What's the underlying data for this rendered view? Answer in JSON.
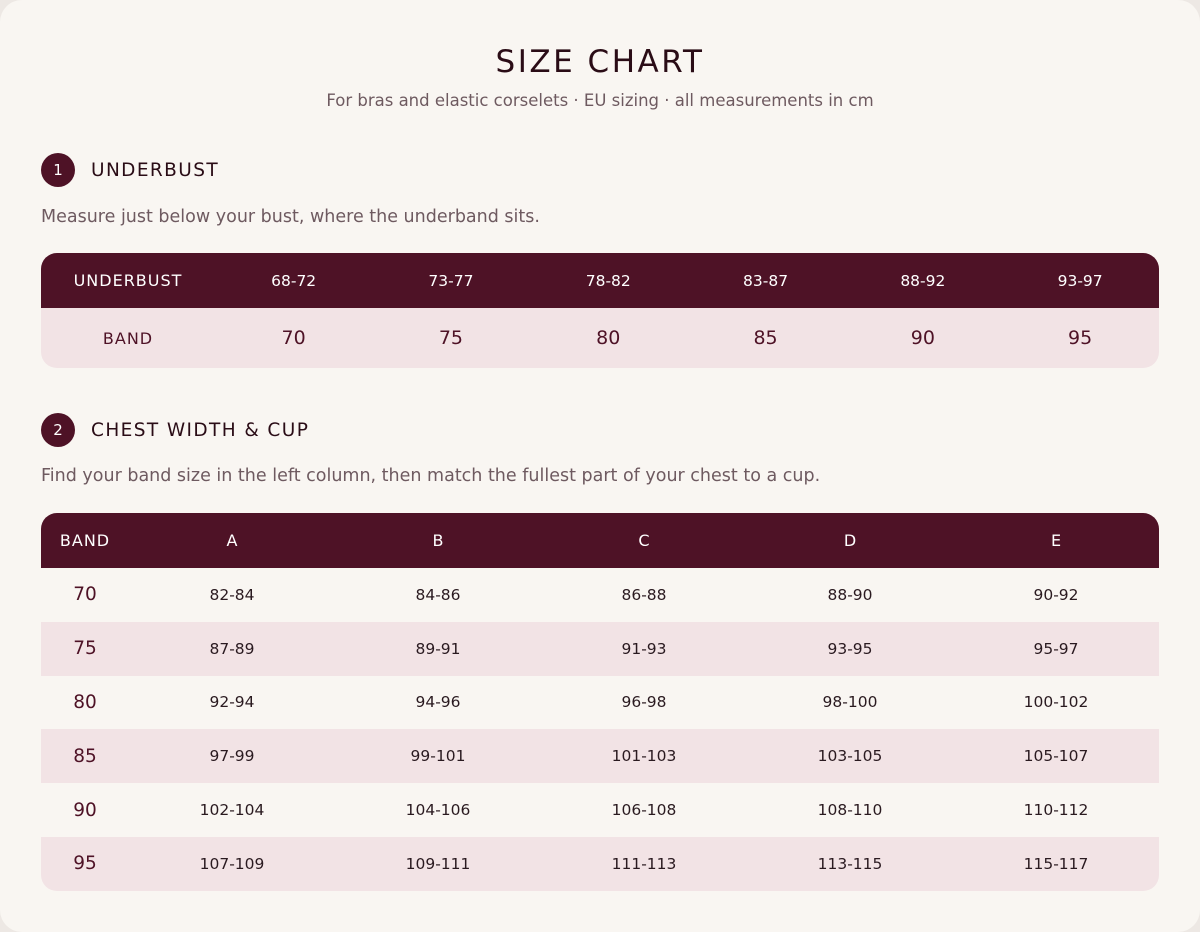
{
  "header": {
    "title": "SIZE CHART",
    "subtitle": "For bras and elastic corselets · EU sizing · all measurements in cm"
  },
  "section1": {
    "number": "1",
    "title": "UNDERBUST",
    "description": "Measure just below your bust, where the underband sits.",
    "row_header_label": "UNDERBUST",
    "row_band_label": "BAND",
    "underbust_ranges": [
      "68-72",
      "73-77",
      "78-82",
      "83-87",
      "88-92",
      "93-97"
    ],
    "band_sizes": [
      "70",
      "75",
      "80",
      "85",
      "90",
      "95"
    ]
  },
  "section2": {
    "number": "2",
    "title": "CHEST WIDTH & CUP",
    "description": "Find your band size in the left column, then match the fullest part of your chest to a cup.",
    "band_header": "BAND",
    "cups": [
      "A",
      "B",
      "C",
      "D",
      "E"
    ],
    "rows": [
      {
        "band": "70",
        "values": [
          "82-84",
          "84-86",
          "86-88",
          "88-90",
          "90-92"
        ]
      },
      {
        "band": "75",
        "values": [
          "87-89",
          "89-91",
          "91-93",
          "93-95",
          "95-97"
        ]
      },
      {
        "band": "80",
        "values": [
          "92-94",
          "94-96",
          "96-98",
          "98-100",
          "100-102"
        ]
      },
      {
        "band": "85",
        "values": [
          "97-99",
          "99-101",
          "101-103",
          "103-105",
          "105-107"
        ]
      },
      {
        "band": "90",
        "values": [
          "102-104",
          "104-106",
          "106-108",
          "108-110",
          "110-112"
        ]
      },
      {
        "band": "95",
        "values": [
          "107-109",
          "109-111",
          "111-113",
          "113-115",
          "115-117"
        ]
      }
    ]
  },
  "colors": {
    "accent": "#4e1226",
    "row_tint": "#f2e3e5",
    "background": "#f9f6f2"
  }
}
